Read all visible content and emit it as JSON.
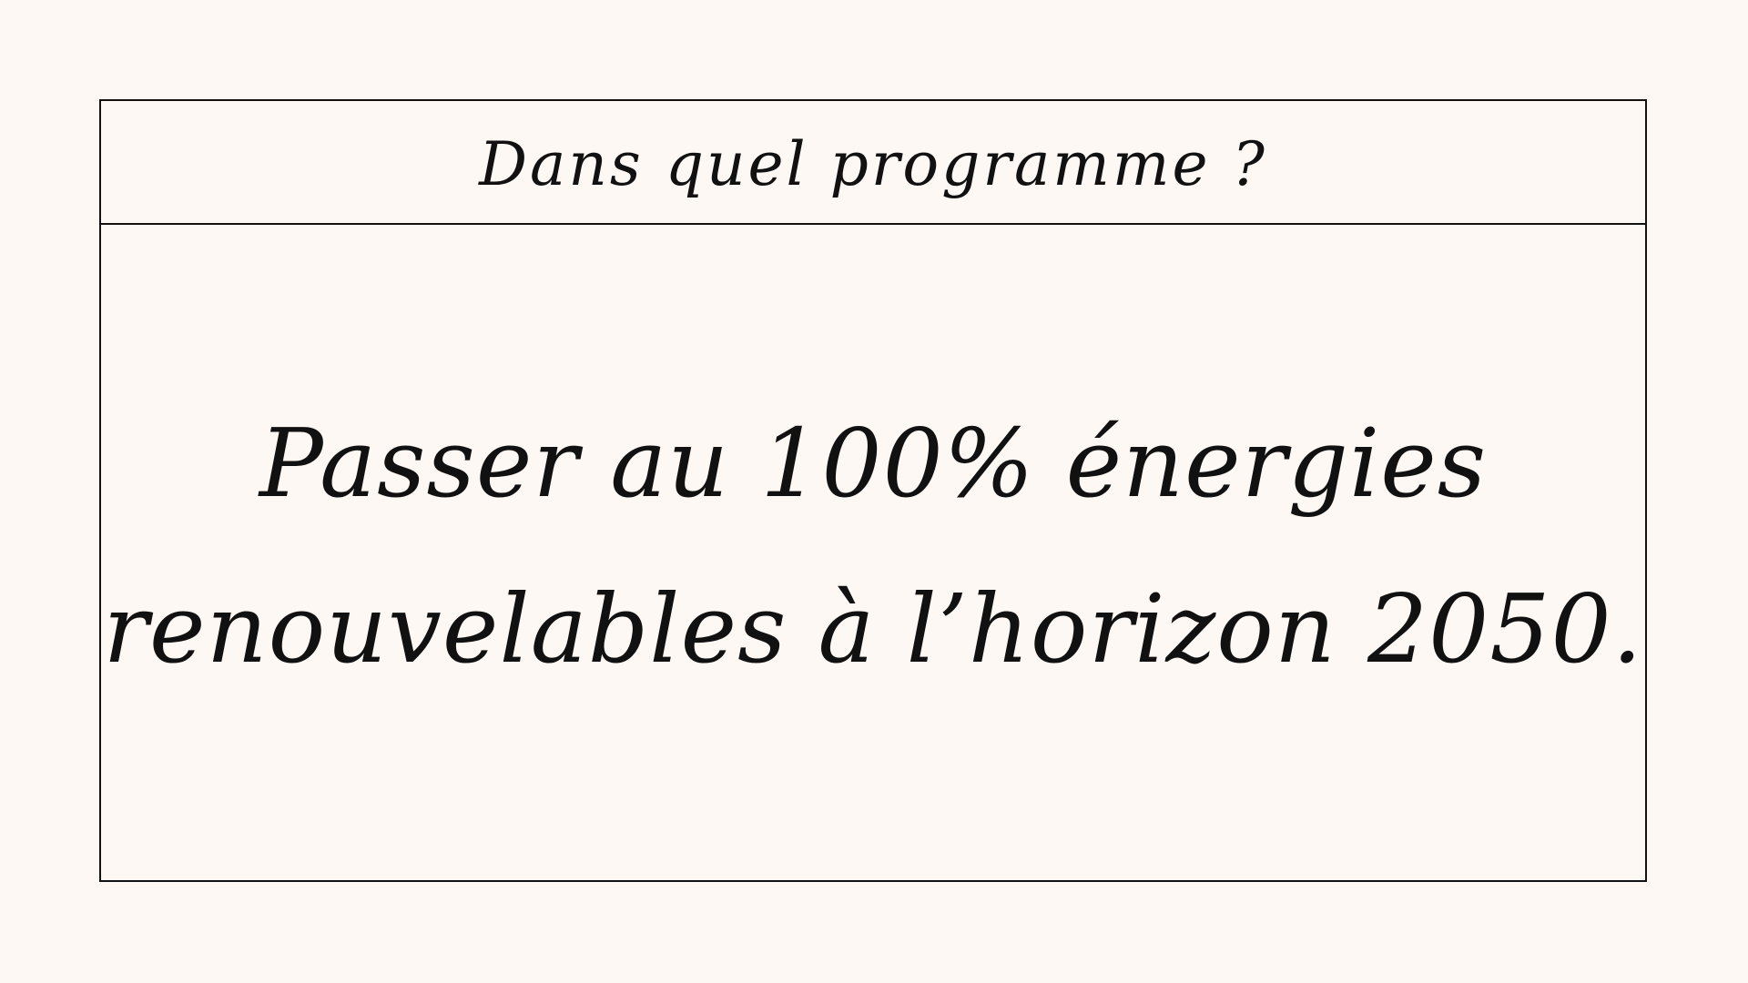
{
  "header": {
    "title": "Dans quel programme ?"
  },
  "statement": {
    "line1": "Passer au 100% énergies",
    "line2": "renouvelables à l’horizon 2050."
  },
  "colors": {
    "background": "#fdf8f4",
    "ink": "#111111"
  }
}
